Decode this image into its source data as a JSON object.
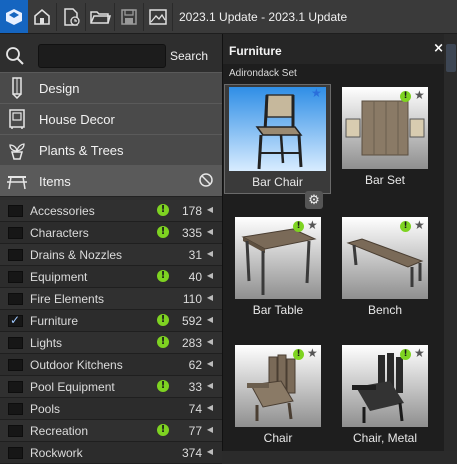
{
  "toolbar": {
    "title": "2023.1 Update - 2023.1 Update",
    "buttons": [
      "home-icon",
      "new-document-icon",
      "open-folder-icon",
      "save-icon",
      "image-icon"
    ]
  },
  "search": {
    "placeholder": "",
    "button_label": "Search"
  },
  "categories": [
    {
      "label": "Design",
      "icon": "pencil-icon"
    },
    {
      "label": "House Decor",
      "icon": "picture-frame-icon"
    },
    {
      "label": "Plants & Trees",
      "icon": "potted-plant-icon"
    },
    {
      "label": "Items",
      "icon": "picnic-table-icon"
    }
  ],
  "items_list": [
    {
      "name": "Accessories",
      "count": "178",
      "alert": true,
      "checked": false
    },
    {
      "name": "Characters",
      "count": "335",
      "alert": true,
      "checked": false
    },
    {
      "name": "Drains & Nozzles",
      "count": "31",
      "alert": false,
      "checked": false
    },
    {
      "name": "Equipment",
      "count": "40",
      "alert": true,
      "checked": false
    },
    {
      "name": "Fire Elements",
      "count": "110",
      "alert": false,
      "checked": false
    },
    {
      "name": "Furniture",
      "count": "592",
      "alert": true,
      "checked": true
    },
    {
      "name": "Lights",
      "count": "283",
      "alert": true,
      "checked": false
    },
    {
      "name": "Outdoor Kitchens",
      "count": "62",
      "alert": false,
      "checked": false
    },
    {
      "name": "Pool Equipment",
      "count": "33",
      "alert": true,
      "checked": false
    },
    {
      "name": "Pools",
      "count": "74",
      "alert": false,
      "checked": false
    },
    {
      "name": "Recreation",
      "count": "77",
      "alert": true,
      "checked": false
    },
    {
      "name": "Rockwork",
      "count": "374",
      "alert": false,
      "checked": false
    }
  ],
  "panel": {
    "title": "Furniture",
    "close": "×",
    "subheading": "Adirondack Set",
    "tiles": [
      {
        "label": "Bar Chair",
        "selected": true,
        "new": false,
        "favorite": true
      },
      {
        "label": "Bar Set",
        "selected": false,
        "new": true,
        "favorite": false
      },
      {
        "label": "Bar Table",
        "selected": false,
        "new": true,
        "favorite": false
      },
      {
        "label": "Bench",
        "selected": false,
        "new": true,
        "favorite": false
      },
      {
        "label": "Chair",
        "selected": false,
        "new": true,
        "favorite": false
      },
      {
        "label": "Chair, Metal",
        "selected": false,
        "new": true,
        "favorite": false
      }
    ]
  },
  "colors": {
    "accent": "#1565c0",
    "new_badge": "#7ed321",
    "favorite_star": "#2a6fdb"
  }
}
